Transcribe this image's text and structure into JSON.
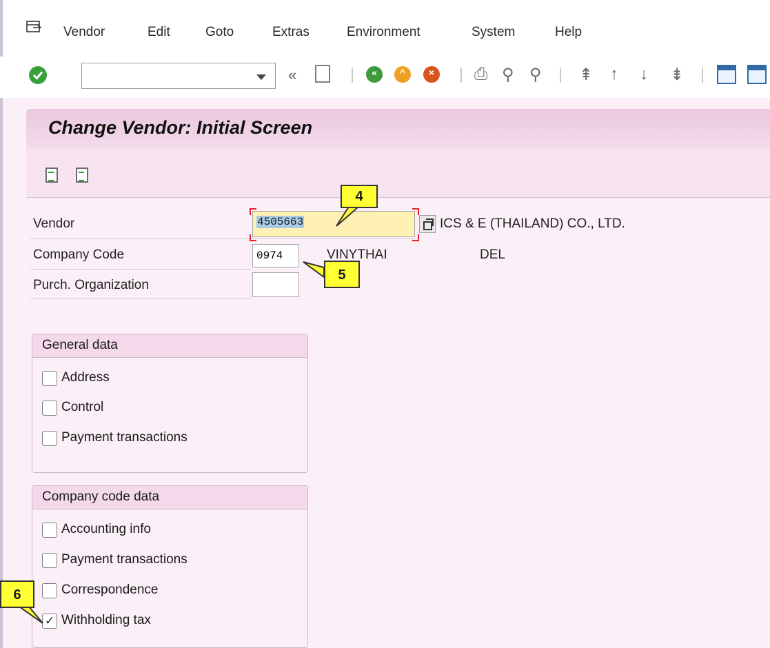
{
  "menubar": {
    "items": [
      "Vendor",
      "Edit",
      "Goto",
      "Extras",
      "Environment",
      "System",
      "Help"
    ]
  },
  "toolbar": {
    "command_field_value": "",
    "icons": [
      "enter-icon",
      "back-icon",
      "save-icon",
      "back-green-icon",
      "exit-icon",
      "cancel-icon",
      "print-icon",
      "find-icon",
      "find-next-icon",
      "first-page-icon",
      "previous-page-icon",
      "next-page-icon",
      "last-page-icon",
      "create-session-icon",
      "shortcut-icon"
    ]
  },
  "screen": {
    "title": "Change Vendor: Initial Screen"
  },
  "fields": {
    "vendor": {
      "label": "Vendor",
      "value": "4505663",
      "description": "ICS & E (THAILAND) CO., LTD."
    },
    "company_code": {
      "label": "Company Code",
      "value": "0974",
      "name": "VINYTHAI",
      "extra": "DEL"
    },
    "purch_org": {
      "label": "Purch. Organization",
      "value": ""
    }
  },
  "general_data": {
    "title": "General data",
    "items": [
      {
        "label": "Address",
        "checked": false
      },
      {
        "label": "Control",
        "checked": false
      },
      {
        "label": "Payment transactions",
        "checked": false
      }
    ]
  },
  "company_code_data": {
    "title": "Company code data",
    "items": [
      {
        "label": "Accounting info",
        "checked": false
      },
      {
        "label": "Payment transactions",
        "checked": false
      },
      {
        "label": "Correspondence",
        "checked": false
      },
      {
        "label": "Withholding tax",
        "checked": true
      }
    ]
  },
  "callouts": [
    "4",
    "5",
    "6"
  ],
  "colors": {
    "background": "#fbf0f7",
    "title_band": "#eac7de",
    "callout": "#ffff33",
    "active_field": "#fff1b3",
    "focus_marker": "#e2232b"
  }
}
